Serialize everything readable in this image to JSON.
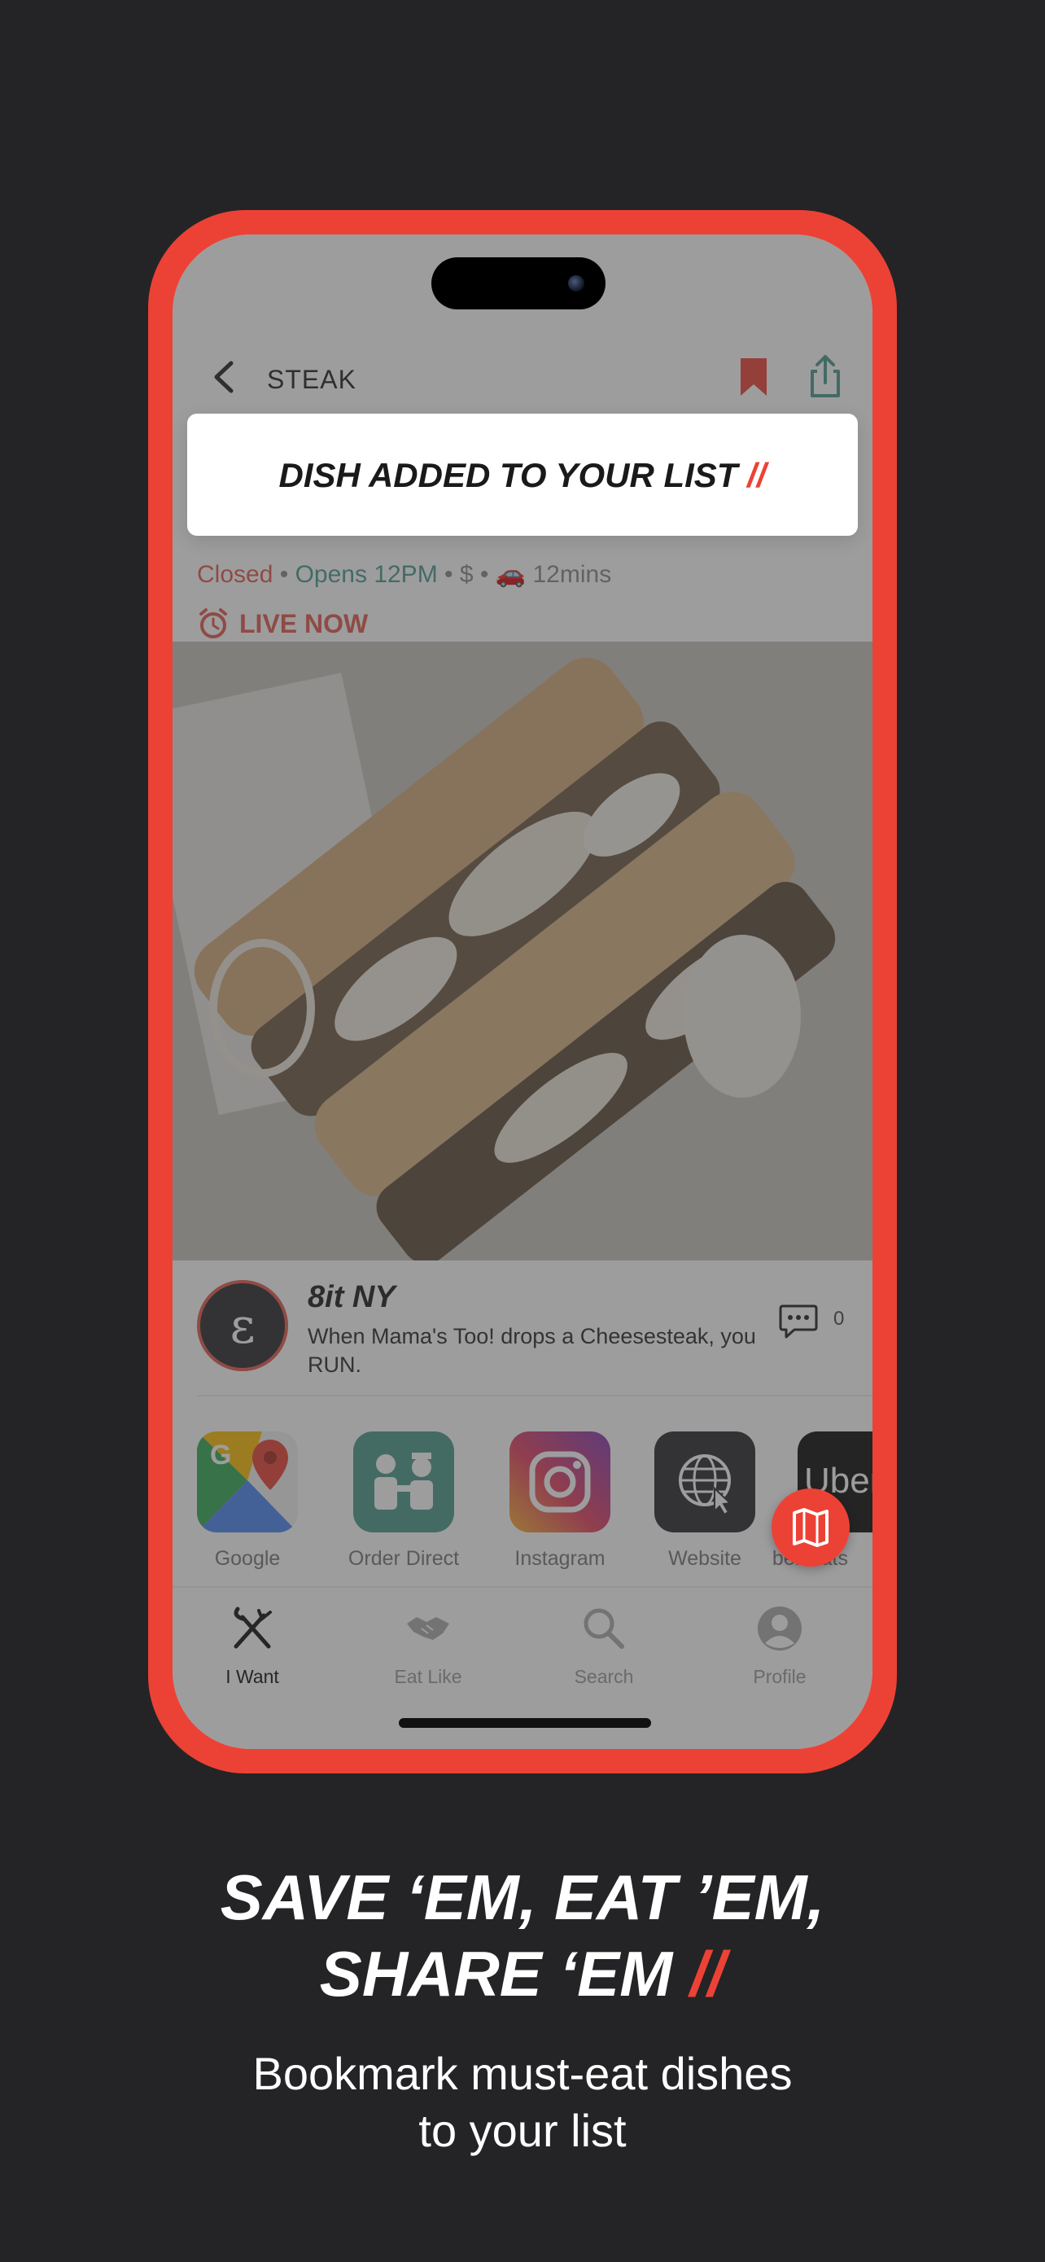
{
  "nav": {
    "title": "STEAK"
  },
  "toast": {
    "message": "DISH ADDED TO YOUR LIST",
    "accent": "//"
  },
  "status": {
    "closed": "Closed",
    "sep1": "•",
    "opens": "Opens 12PM",
    "sep2": "•",
    "price": "$",
    "sep3": "•",
    "time": "12mins"
  },
  "live": {
    "label": "LIVE NOW"
  },
  "post": {
    "avatar_glyph": "ε",
    "author": "8it NY",
    "caption": "When Mama's Too! drops a Cheesesteak, you RUN.",
    "comment_count": "0"
  },
  "apps": [
    {
      "label": "Google",
      "icon": "google-maps-icon"
    },
    {
      "label": "Order Direct",
      "icon": "handshake-chef-icon"
    },
    {
      "label": "Instagram",
      "icon": "instagram-icon"
    },
    {
      "label": "Website",
      "icon": "globe-icon"
    },
    {
      "label": "Uber Eats",
      "icon": "uber-eats-icon",
      "tile_text": "Uber"
    }
  ],
  "tabs": [
    {
      "label": "I Want",
      "icon": "fork-knife-icon",
      "active": true
    },
    {
      "label": "Eat Like",
      "icon": "handshake-icon",
      "active": false
    },
    {
      "label": "Search",
      "icon": "search-icon",
      "active": false
    },
    {
      "label": "Profile",
      "icon": "profile-icon",
      "active": false
    }
  ],
  "marketing": {
    "headline_line1": "SAVE ‘EM, EAT ’EM,",
    "headline_line2": "SHARE ‘EM",
    "headline_accent": "//",
    "subtitle_line1": "Bookmark must-eat dishes",
    "subtitle_line2": "to your list"
  },
  "colors": {
    "accent": "#ec4235",
    "background": "#242426",
    "teal": "#4a9a8a"
  }
}
